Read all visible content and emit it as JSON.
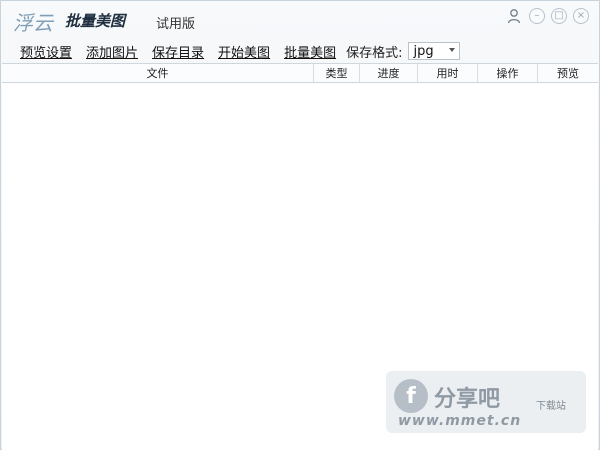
{
  "titlebar": {
    "logo": "浮云",
    "app_name": "批量美图",
    "edition": "试用版",
    "controls": {
      "user": "user-icon",
      "minimize": "minimize-icon",
      "maximize": "maximize-icon",
      "close": "close-icon"
    }
  },
  "toolbar": {
    "items": [
      {
        "label": "预览设置"
      },
      {
        "label": "添加图片"
      },
      {
        "label": "保存目录"
      },
      {
        "label": "开始美图"
      },
      {
        "label": "批量美图"
      }
    ],
    "format_label": "保存格式:",
    "format_value": "jpg"
  },
  "table": {
    "columns": [
      "文件",
      "类型",
      "进度",
      "用时",
      "操作",
      "预览"
    ]
  },
  "watermark": {
    "logo_letter": "f",
    "title": "分享吧",
    "subtitle": "下载站",
    "url": "www.mmet.cn"
  }
}
